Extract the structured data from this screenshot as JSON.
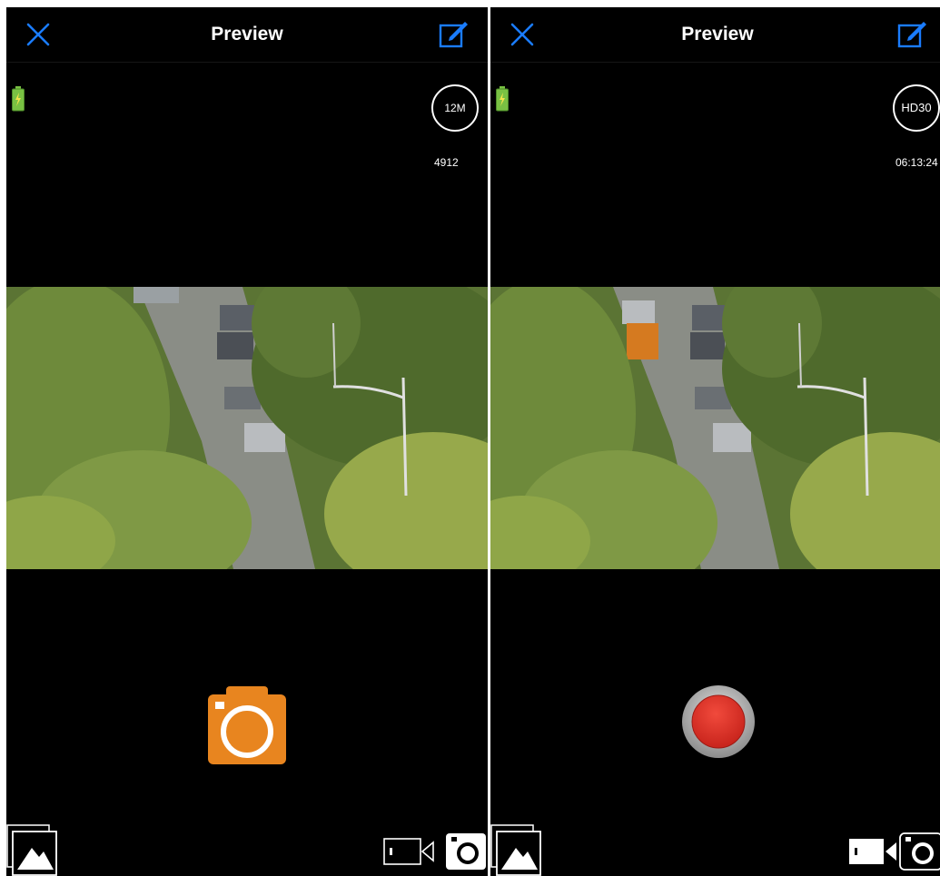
{
  "screens": [
    {
      "mode": "photo",
      "title": "Preview",
      "resolution": "12M",
      "remaining": "4912"
    },
    {
      "mode": "video",
      "title": "Preview",
      "resolution": "HD30",
      "remaining": "06:13:24"
    }
  ],
  "colors": {
    "accent": "#1a7cff",
    "shutter_photo": "#e8851f",
    "record": "#e7342b",
    "battery": "#79c143",
    "background": "#000000"
  },
  "icons": {
    "close": "close-icon",
    "edit": "edit-icon",
    "battery": "battery-icon",
    "gallery": "gallery-icon",
    "video_mode": "video-camera-icon",
    "photo_mode": "camera-icon"
  }
}
